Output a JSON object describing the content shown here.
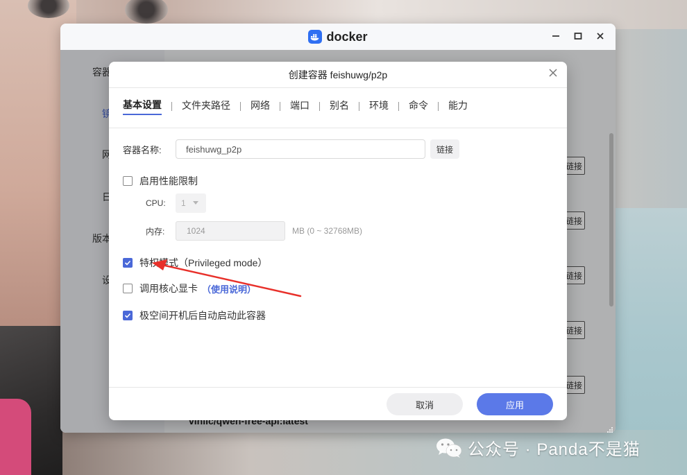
{
  "docker_window": {
    "title": "docker",
    "sidebar_items": [
      "容器",
      "镜",
      "网",
      "日",
      "版本",
      "设"
    ],
    "bg_button_label": "链接",
    "bg_image_name": "vinlic/qwen-free-api:latest"
  },
  "modal": {
    "title": "创建容器 feishuwg/p2p",
    "tabs": [
      "基本设置",
      "文件夹路径",
      "网络",
      "端口",
      "别名",
      "环境",
      "命令",
      "能力"
    ],
    "active_tab": "基本设置",
    "container_name_label": "容器名称:",
    "container_name_value": "feishuwg_p2p",
    "link_button": "链接",
    "perf_limit_label": "启用性能限制",
    "perf_limit_checked": false,
    "cpu_label": "CPU:",
    "cpu_value": "1",
    "memory_label": "内存:",
    "memory_value": "1024",
    "memory_unit": "MB (0 ~ 32768MB)",
    "privileged_label": "特权模式（Privileged mode）",
    "privileged_checked": true,
    "gpu_label": "调用核心显卡",
    "gpu_link": "（使用说明）",
    "gpu_checked": false,
    "autostart_label": "极空间开机后自动启动此容器",
    "autostart_checked": true,
    "cancel_button": "取消",
    "apply_button": "应用"
  },
  "watermark": "公众号 · Panda不是猫",
  "colors": {
    "accent": "#4a68d8",
    "apply": "#5b79e8",
    "annotation_arrow": "#e8302a"
  }
}
